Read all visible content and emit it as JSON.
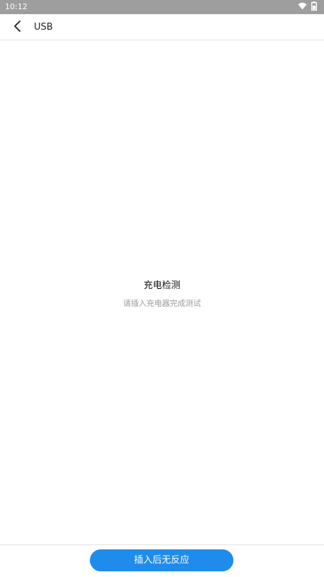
{
  "status_bar": {
    "time": "10:12",
    "icons": [
      "wifi-icon",
      "battery-icon"
    ]
  },
  "app_bar": {
    "back_icon": "chevron-left-icon",
    "title": "USB"
  },
  "content": {
    "title": "充电检测",
    "subtitle": "请插入充电器完成测试"
  },
  "footer": {
    "button_label": "插入后无反应",
    "button_color": "#1f8ceb"
  }
}
